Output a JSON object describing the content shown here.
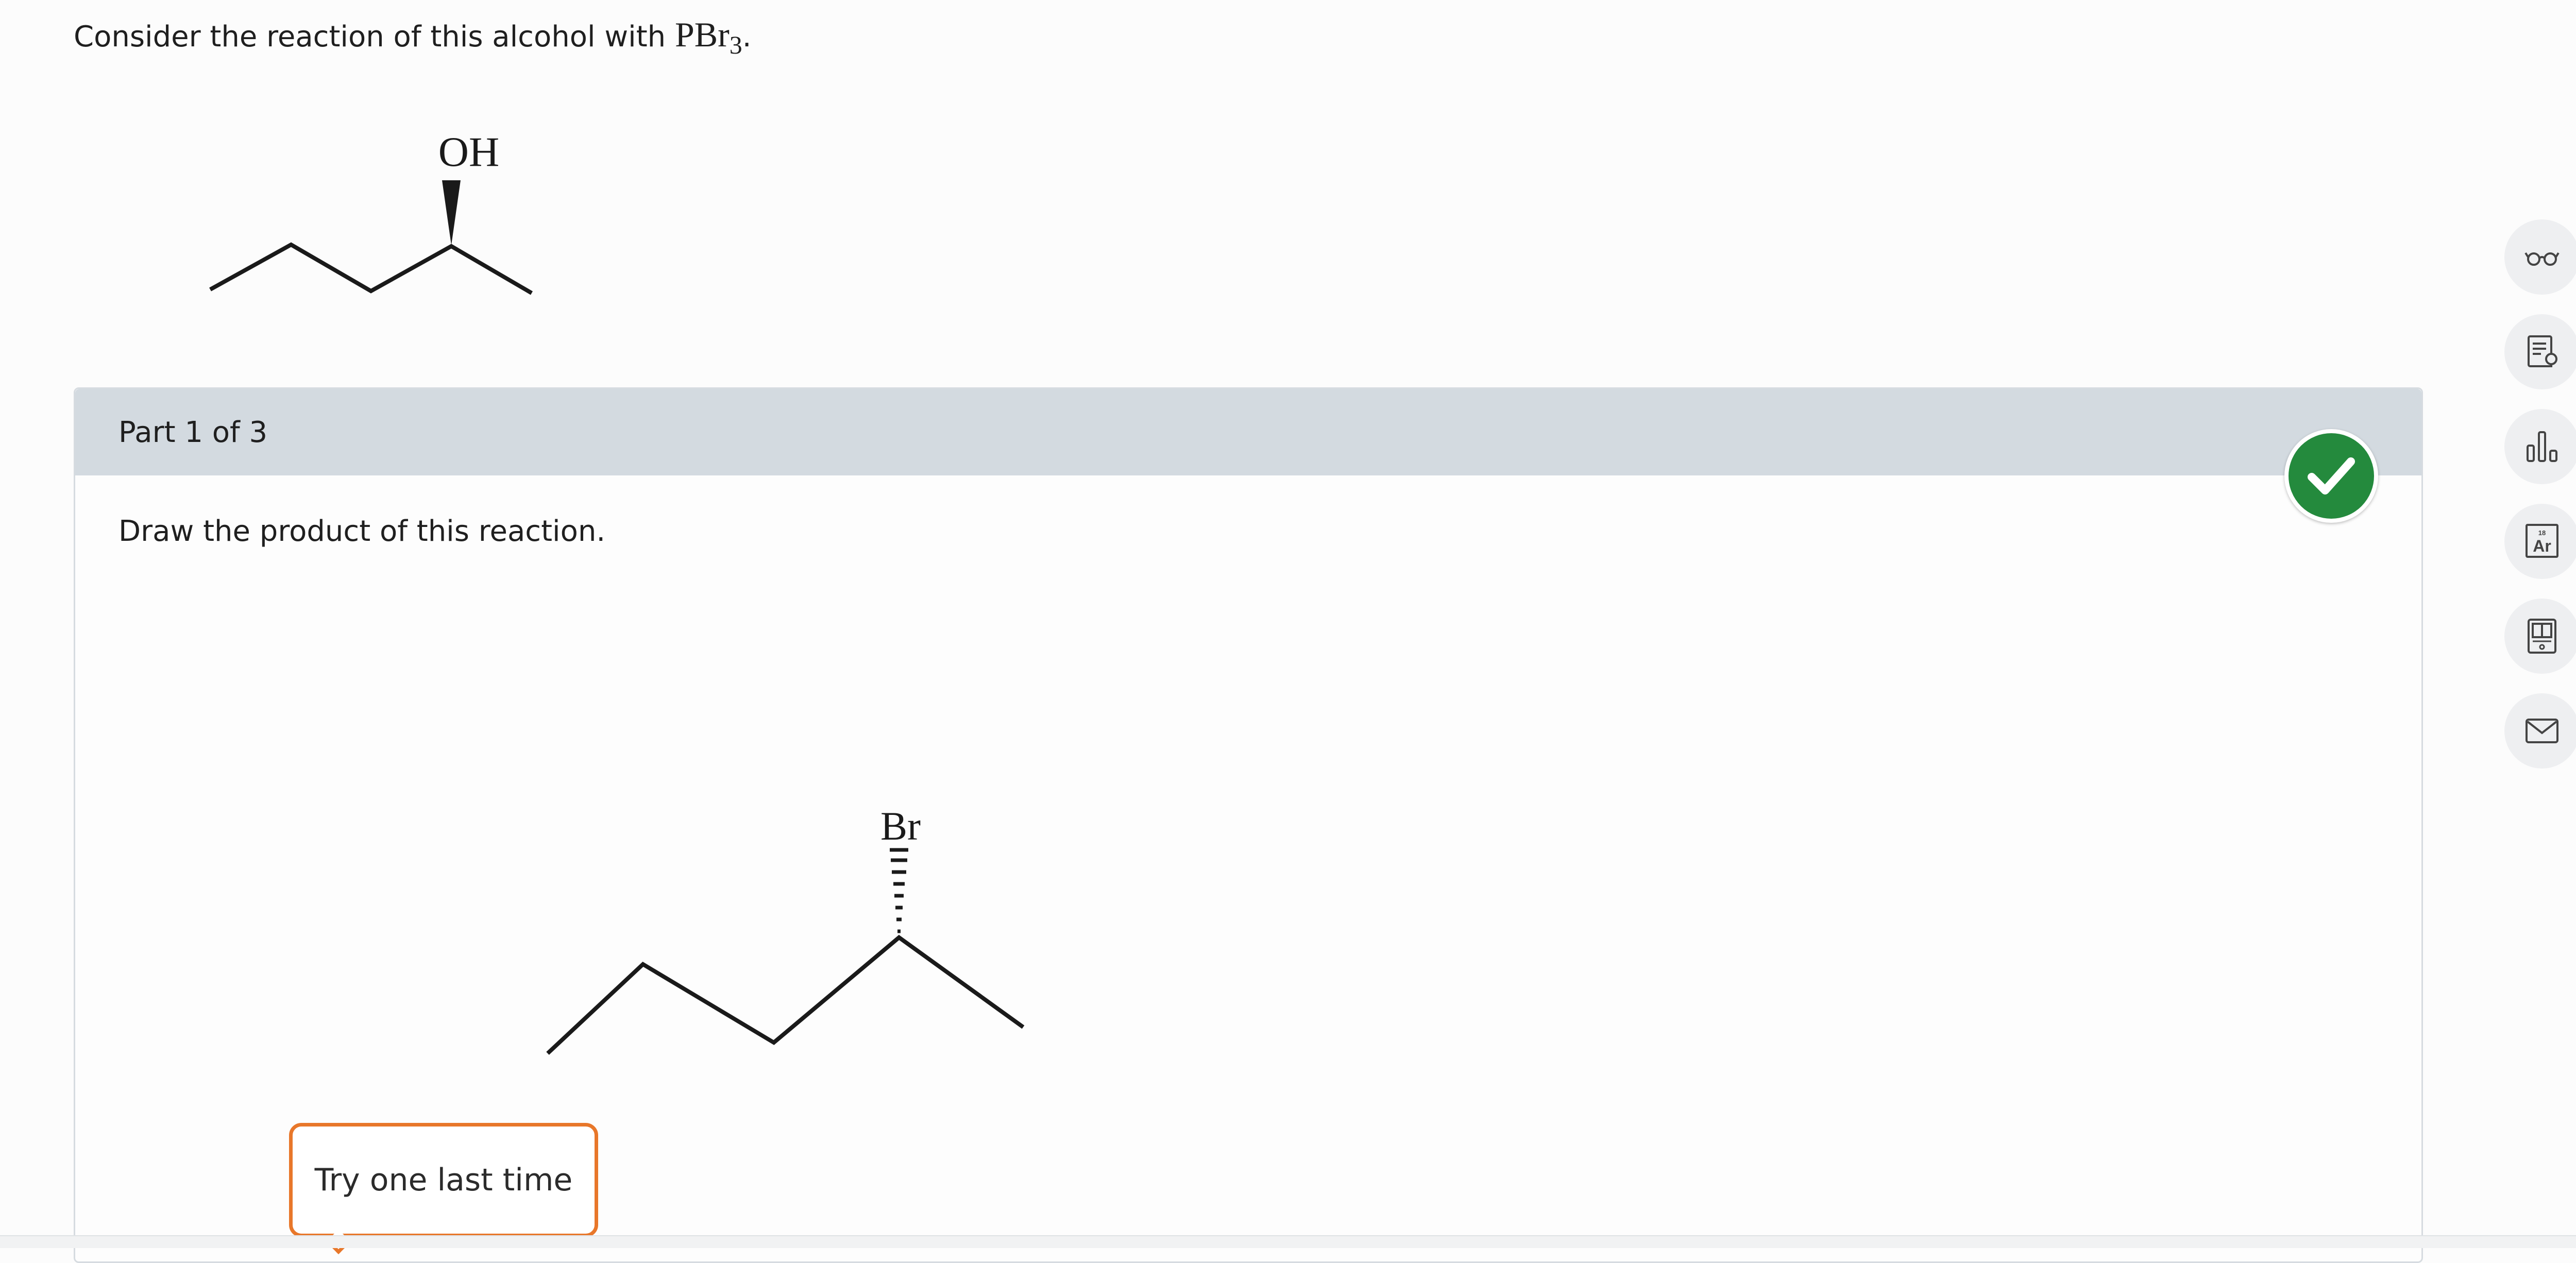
{
  "question": {
    "text": "Consider the reaction of this alcohol with",
    "reagent_main": "PBr",
    "reagent_subscript": "3",
    "reagent_suffix": "."
  },
  "reactant": {
    "label": "OH"
  },
  "part": {
    "title": "Part 1 of 3",
    "instruction": "Draw the product of this reaction.",
    "status": "correct"
  },
  "product": {
    "label": "Br"
  },
  "feedback": {
    "text": "Try one last time"
  },
  "toolbar": {
    "items": [
      {
        "icon": "glasses-icon"
      },
      {
        "icon": "document-hint-icon"
      },
      {
        "icon": "bar-chart-icon"
      },
      {
        "icon": "periodic-table-icon",
        "symbol": "Ar",
        "number": "18"
      },
      {
        "icon": "calculator-book-icon"
      },
      {
        "icon": "mail-icon"
      }
    ]
  },
  "colors": {
    "accent_success": "#248a3d",
    "feedback_border": "#e8772a",
    "part_header_bg": "#d3dae0",
    "toolbar_btn_bg": "#eeeff1"
  }
}
